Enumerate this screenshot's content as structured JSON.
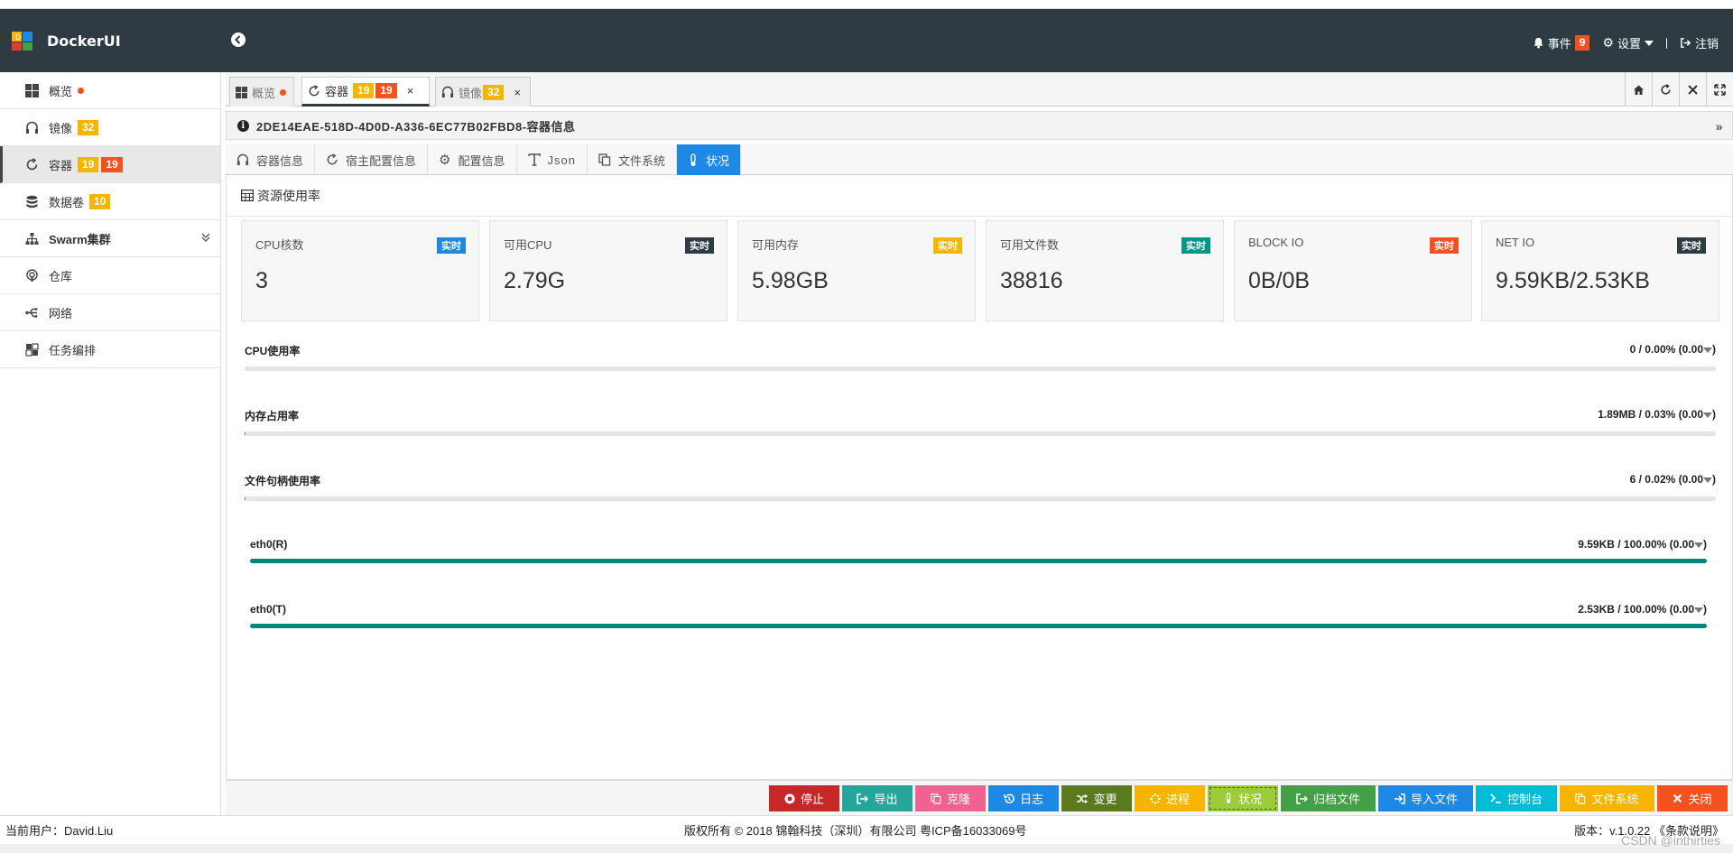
{
  "app": {
    "title": "DockerUI",
    "events_label": "事件",
    "events_count": "9",
    "settings_label": "设置",
    "logout_label": "注销"
  },
  "sidebar": {
    "items": [
      {
        "label": "概览",
        "icon": "windows-icon"
      },
      {
        "label": "镜像",
        "icon": "headphones-icon",
        "badge": "32"
      },
      {
        "label": "容器",
        "icon": "refresh-icon",
        "badge1": "19",
        "badge2": "19"
      },
      {
        "label": "数据卷",
        "icon": "database-icon",
        "badge": "10"
      },
      {
        "label": "Swarm集群",
        "icon": "sitemap-icon"
      },
      {
        "label": "仓库",
        "icon": "podcast-icon"
      },
      {
        "label": "网络",
        "icon": "usb-icon"
      },
      {
        "label": "任务编排",
        "icon": "puzzle-icon"
      }
    ]
  },
  "tabs": {
    "overview": {
      "label": "概览"
    },
    "containers": {
      "label": "容器",
      "badge1": "19",
      "badge2": "19",
      "close": "×"
    },
    "images": {
      "label": "镜像",
      "badge": "32",
      "close": "×"
    }
  },
  "container": {
    "title": "2DE14EAE-518D-4D0D-A336-6EC77B02FBD8-容器信息"
  },
  "subtabs": [
    "容器信息",
    "宿主配置信息",
    "配置信息",
    "Json",
    "文件系统",
    "状况"
  ],
  "panel": {
    "title": "资源使用率"
  },
  "cards": [
    {
      "label": "CPU核数",
      "badge": "实时",
      "value": "3",
      "color": "#1e88e5"
    },
    {
      "label": "可用CPU",
      "badge": "实时",
      "value": "2.79G",
      "color": "#2e3b42"
    },
    {
      "label": "可用内存",
      "badge": "实时",
      "value": "5.98GB",
      "color": "#f7b500"
    },
    {
      "label": "可用文件数",
      "badge": "实时",
      "value": "38816",
      "color": "#009688"
    },
    {
      "label": "BLOCK IO",
      "badge": "实时",
      "value": "0B/0B",
      "color": "#f4511e"
    },
    {
      "label": "NET IO",
      "badge": "实时",
      "value": "9.59KB/2.53KB",
      "color": "#2e3b42"
    }
  ],
  "meters": [
    {
      "label": "CPU使用率",
      "value": "0 / 0.00%",
      "extra": "(0.00",
      "percent": 0
    },
    {
      "label": "内存占用率",
      "value": "1.89MB / 0.03%",
      "extra": "(0.00",
      "percent": 0.03
    },
    {
      "label": "文件句柄使用率",
      "value": "6 / 0.02%",
      "extra": "(0.00",
      "percent": 0.02
    },
    {
      "label": "eth0(R)",
      "value": "9.59KB / 100.00%",
      "extra": "(0.00",
      "percent": 100
    },
    {
      "label": "eth0(T)",
      "value": "2.53KB / 100.00%",
      "extra": "(0.00",
      "percent": 100
    }
  ],
  "actions": [
    {
      "label": "停止",
      "color": "#c62828",
      "icon": "stop-icon"
    },
    {
      "label": "导出",
      "color": "#26a69a",
      "icon": "export-icon"
    },
    {
      "label": "克隆",
      "color": "#f06292",
      "icon": "clone-icon"
    },
    {
      "label": "日志",
      "color": "#1e88e5",
      "icon": "history-icon"
    },
    {
      "label": "变更",
      "color": "#5b7a1e",
      "icon": "shuffle-icon"
    },
    {
      "label": "进程",
      "color": "#f7b500",
      "icon": "spinner-icon"
    },
    {
      "label": "状况",
      "color": "#9ccc3c",
      "icon": "thermometer-icon"
    },
    {
      "label": "归档文件",
      "color": "#43a047",
      "icon": "archive-icon"
    },
    {
      "label": "导入文件",
      "color": "#1e88e5",
      "icon": "import-icon"
    },
    {
      "label": "控制台",
      "color": "#00bcd4",
      "icon": "terminal-icon"
    },
    {
      "label": "文件系统",
      "color": "#f7b500",
      "icon": "copy-icon"
    },
    {
      "label": "关闭",
      "color": "#f4511e",
      "icon": "close-icon"
    }
  ],
  "footer": {
    "user": "当前用户：David.Liu",
    "copyright": "版权所有 © 2018 锦翰科技（深圳）有限公司 粤ICP备16033069号",
    "version": "版本：v.1.0.22 《条款说明》",
    "watermark": "CSDN @inthirties"
  }
}
